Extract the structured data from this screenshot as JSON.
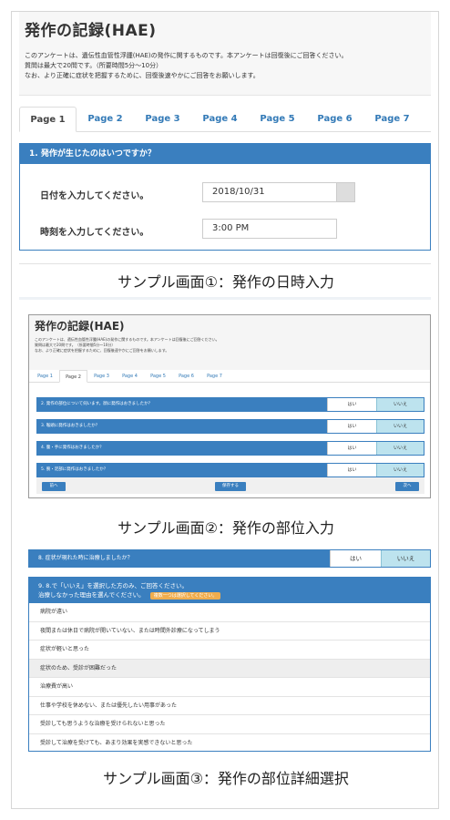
{
  "screen1": {
    "title": "発作の記録(HAE)",
    "desc": [
      "このアンケートは、遺伝性血管性浮腫(HAE)の発作に関するものです。本アンケートは回復後にご回答ください。",
      "質問は最大で20問です。（所要時間5分〜10分）",
      "なお、より正確に症状を把握するために、回復後速やかにご回答をお願いします。"
    ],
    "tabs": [
      "Page 1",
      "Page 2",
      "Page 3",
      "Page 4",
      "Page 5",
      "Page 6",
      "Page 7"
    ],
    "question": "1. 発作が生じたのはいつですか？",
    "date_label": "日付を入力してください。",
    "date_value": "2018/10/31",
    "time_label": "時刻を入力してください。",
    "time_value": "3:00 PM",
    "caption": "サンプル画面①：発作の日時入力"
  },
  "screen2": {
    "title": "発作の記録(HAE)",
    "desc": [
      "このアンケートは、遺伝性血管性浮腫(HAE)の発作に関するものです。本アンケートは回復後にご回答ください。",
      "質問は最大で20問です。（所要時間5分〜10分）",
      "なお、より正確に症状を把握するために、回復後速やかにご回答をお願いします。"
    ],
    "tabs": [
      "Page 1",
      "Page 2",
      "Page 3",
      "Page 4",
      "Page 5",
      "Page 6",
      "Page 7"
    ],
    "rows": [
      {
        "q": "2. 発作の部位について伺います。顔に発作はおきましたか？",
        "yes": "はい",
        "no": "いいえ"
      },
      {
        "q": "3. 喉頭に発作はおきましたか？",
        "yes": "はい",
        "no": "いいえ"
      },
      {
        "q": "4. 腹・手に発作はおきましたか？",
        "yes": "はい",
        "no": "いいえ"
      },
      {
        "q": "5. 腕・足部に発作はおきましたか？",
        "yes": "はい",
        "no": "いいえ"
      }
    ],
    "prev": "前へ",
    "save": "保存する",
    "next": "次へ",
    "caption": "サンプル画面②：発作の部位入力"
  },
  "screen3": {
    "row": {
      "q": "8. 症状が現れた時に治療しましたか？",
      "yes": "はい",
      "no": "いいえ"
    },
    "panel_line1": "9. 8.で「いいえ」を選択した方のみ、ご回答ください。",
    "panel_line2": "治療しなかった理由を選んでください。",
    "badge": "複数一つは選択してください。",
    "options": [
      "病院が遠い",
      "夜間または休日で病院が開いていない、または時間外診療になってしまう",
      "症状が軽いと思った",
      "症状のため、受診が困難だった",
      "治療費が高い",
      "仕事や学校を休めない、または優先したい用事があった",
      "受診しても思うような治療を受けられないと思った",
      "受診して治療を受けても、あまり効果を実感できないと思った"
    ],
    "caption": "サンプル画面③：発作の部位詳細選択"
  },
  "colors": {
    "primary": "#3a7fbf",
    "selected": "#bde3ee",
    "badge": "#f0ad4e"
  }
}
